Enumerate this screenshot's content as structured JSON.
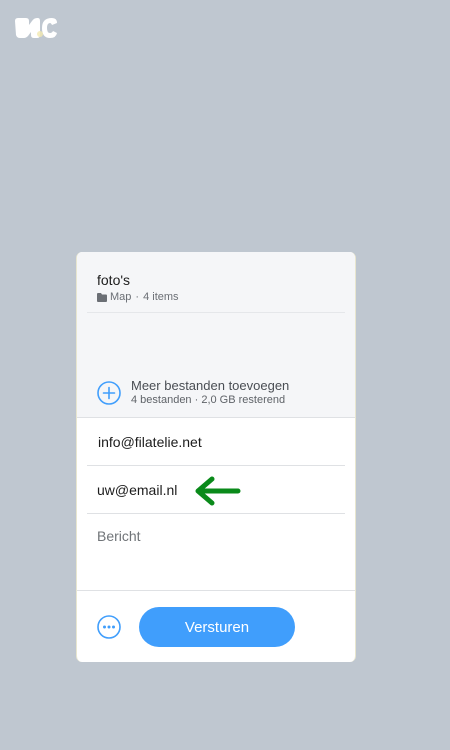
{
  "logo": {
    "icon": "wetransfer-logo-icon"
  },
  "files": {
    "items": [
      {
        "name": "foto's",
        "type": "Map",
        "count": "4 items",
        "icon": "folder-icon"
      }
    ],
    "add_more": {
      "title": "Meer bestanden toevoegen",
      "subtitle": "4 bestanden · 2,0 GB resterend",
      "icon": "plus-circle-icon"
    }
  },
  "form": {
    "email_to": "info@filatelie.net",
    "email_from": "uw@email.nl",
    "message_placeholder": "Bericht"
  },
  "footer": {
    "more_icon": "more-options-icon",
    "send_label": "Versturen"
  },
  "annotation": {
    "arrow_icon": "green-arrow-left-icon",
    "arrow_color": "#0a8a1a"
  },
  "colors": {
    "background": "#bfc7d0",
    "accent": "#409efc"
  }
}
